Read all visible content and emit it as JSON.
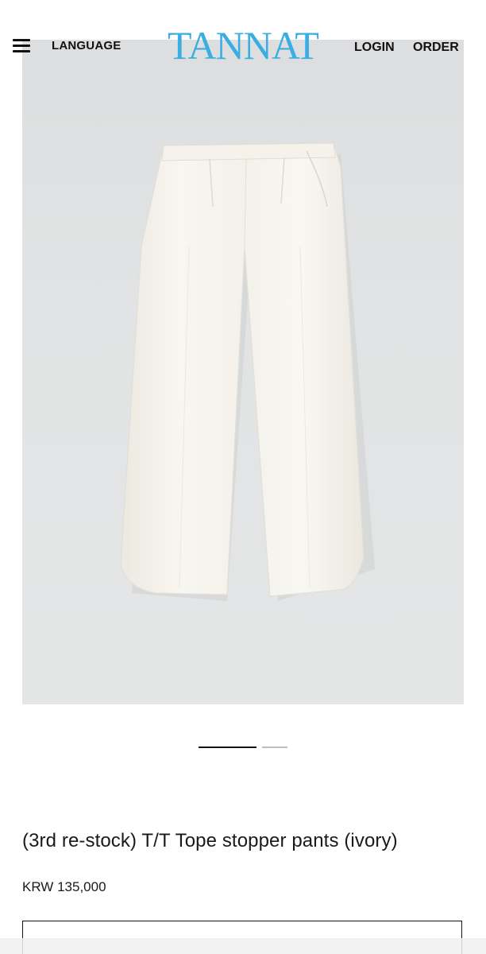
{
  "header": {
    "menu_icon": "hamburger-menu-icon",
    "language_label": "LANGUAGE",
    "logo_text": "TANNAT",
    "login_label": "LOGIN",
    "order_label": "ORDER"
  },
  "colors": {
    "logo": "#3aaee0",
    "text": "#1a1a1a",
    "photo_background": "#e1e3e4",
    "garment": "#f6f4ee"
  },
  "gallery": {
    "image_subject": "ivory wide pants",
    "current_slide": 1,
    "total_slides": 2
  },
  "product": {
    "title": "(3rd re-stock) T/T Tope stopper pants (ivory)",
    "price": "KRW 135,000"
  }
}
